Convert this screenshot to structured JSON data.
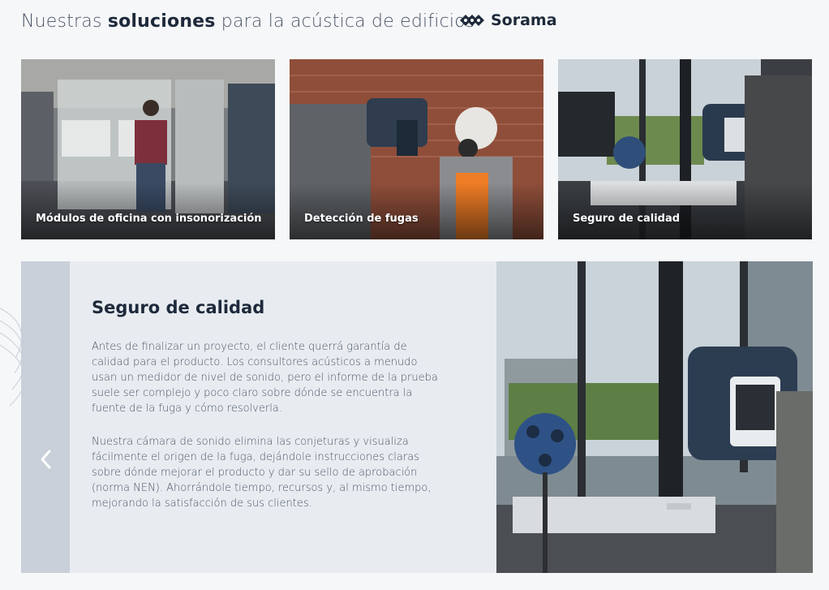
{
  "header": {
    "title_pre": "Nuestras ",
    "title_bold": "soluciones",
    "title_post": " para la acústica de edificios",
    "logo_text": "Sorama"
  },
  "cards": [
    {
      "label": "Módulos de oficina con insonorización",
      "icon": "office-pod-photo"
    },
    {
      "label": "Detección de fugas",
      "icon": "leak-detection-photo"
    },
    {
      "label": "Seguro de calidad",
      "icon": "quality-assurance-photo"
    }
  ],
  "detail": {
    "heading": "Seguro de calidad",
    "paragraph_1": "Antes de finalizar un proyecto, el cliente querrá garantía de calidad para el producto. Los consultores acústicos a menudo usan un medidor de nivel de sonido, pero el informe de la prueba suele ser complejo y poco claro sobre dónde se encuentra la fuente de la fuga y cómo resolverla.",
    "paragraph_2": "Nuestra cámara de sonido elimina las conjeturas y visualiza fácilmente el origen de la fuga, dejándole instrucciones claras sobre dónde mejorar el producto y dar su sello de aprobación (norma NEN). Ahorrándole tiempo, recursos y, al mismo tiempo, mejorando la satisfacción de sus clientes.",
    "prev_icon": "chevron-left-icon"
  },
  "colors": {
    "text_dark": "#1e2a3b",
    "text_body": "#4a5566",
    "panel_bg": "#e8ecf1",
    "side_strip": "#c9d0da"
  }
}
